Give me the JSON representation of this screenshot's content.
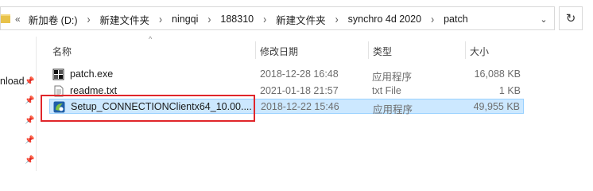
{
  "breadcrumb": {
    "overflow": "«",
    "items": [
      "新加卷 (D:)",
      "新建文件夹",
      "ningqi",
      "188310",
      "新建文件夹",
      "synchro 4d 2020",
      "patch"
    ]
  },
  "nav": {
    "partial_label": "nload"
  },
  "columns": {
    "name": "名称",
    "date": "修改日期",
    "type": "类型",
    "size": "大小"
  },
  "files": [
    {
      "name": "patch.exe",
      "date": "2018-12-28 16:48",
      "type": "应用程序",
      "size": "16,088 KB",
      "icon": "exe-icon"
    },
    {
      "name": "readme.txt",
      "date": "2021-01-18 21:57",
      "type": "txt File",
      "size": "1 KB",
      "icon": "txt-icon"
    },
    {
      "name": "Setup_CONNECTIONClientx64_10.00....",
      "date": "2018-12-22 15:46",
      "type": "应用程序",
      "size": "49,955 KB",
      "icon": "installer-icon"
    }
  ],
  "colors": {
    "selection": "#cce8ff",
    "selection_border": "#99d1ff",
    "highlight": "#e0262b"
  }
}
